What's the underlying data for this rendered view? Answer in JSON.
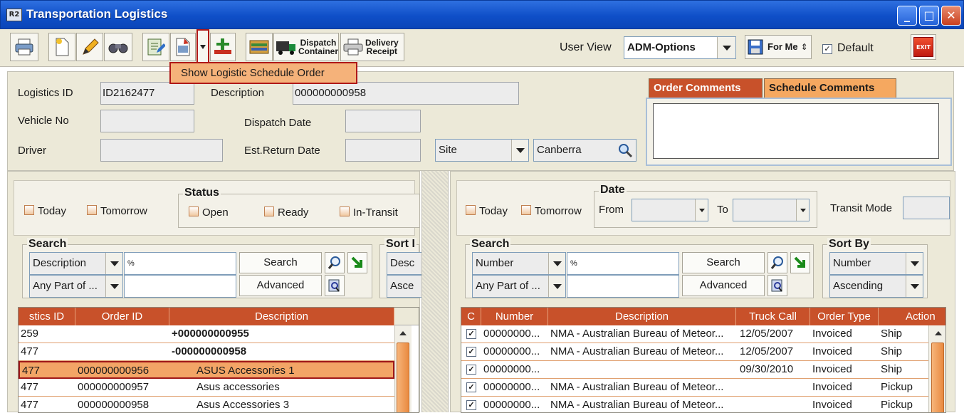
{
  "window": {
    "title": "Transportation Logistics",
    "icon_text": "R2"
  },
  "toolbar": {
    "dispatch_label_1": "Dispatch",
    "dispatch_label_2": "Container",
    "delivery_label_1": "Delivery",
    "delivery_label_2": "Receipt",
    "user_view_label": "User View",
    "user_view_value": "ADM-Options",
    "for_me_label": "For Me",
    "default_label": "Default",
    "exit_label": "EXIT"
  },
  "popup": {
    "label": "Show Logistic Schedule Order"
  },
  "form": {
    "logistics_id_label": "Logistics ID",
    "logistics_id_value": "ID2162477",
    "description_label": "Description",
    "description_value": "000000000958",
    "vehicle_no_label": "Vehicle No",
    "dispatch_date_label": "Dispatch Date",
    "driver_label": "Driver",
    "est_return_label": "Est.Return Date",
    "site_select": "Site",
    "site_value": "Canberra",
    "tabs": [
      "Order Comments",
      "Schedule Comments"
    ]
  },
  "left": {
    "today": "Today",
    "tomorrow": "Tomorrow",
    "status_title": "Status",
    "status_open": "Open",
    "status_ready": "Ready",
    "status_intransit": "In-Transit",
    "search_title": "Search",
    "search_field": "Description",
    "search_value": "%",
    "search_button": "Search",
    "match_mode": "Any Part of ...",
    "advanced_button": "Advanced",
    "sort_title": "Sort I",
    "sort_field": "Desc",
    "sort_order": "Asce",
    "columns": [
      "stics ID",
      "Order ID",
      "Description"
    ],
    "rows": [
      {
        "id": "259",
        "order": "",
        "desc": "+000000000955"
      },
      {
        "id": "477",
        "order": "",
        "desc": "-000000000958"
      },
      {
        "id": "477",
        "order": "000000000956",
        "desc": "ASUS Accessories 1"
      },
      {
        "id": "477",
        "order": "000000000957",
        "desc": "Asus accessories"
      },
      {
        "id": "477",
        "order": "000000000958",
        "desc": "Asus Accessories 3"
      }
    ]
  },
  "right": {
    "today": "Today",
    "tomorrow": "Tomorrow",
    "date_title": "Date",
    "from_label": "From",
    "to_label": "To",
    "transit_mode_label": "Transit Mode",
    "search_title": "Search",
    "search_field": "Number",
    "search_value": "%",
    "search_button": "Search",
    "match_mode": "Any Part of ...",
    "advanced_button": "Advanced",
    "sort_title": "Sort By",
    "sort_field": "Number",
    "sort_order": "Ascending",
    "columns": [
      "C",
      "Number",
      "Description",
      "Truck Call",
      "Order Type",
      "Action"
    ],
    "rows": [
      {
        "number": "00000000...",
        "desc": "NMA - Australian Bureau of Meteor...",
        "truck": "12/05/2007",
        "type": "Invoiced",
        "action": "Ship"
      },
      {
        "number": "00000000...",
        "desc": "NMA - Australian Bureau of Meteor...",
        "truck": "12/05/2007",
        "type": "Invoiced",
        "action": "Ship"
      },
      {
        "number": "00000000...",
        "desc": "",
        "truck": "09/30/2010",
        "type": "Invoiced",
        "action": "Ship"
      },
      {
        "number": "00000000...",
        "desc": "NMA - Australian Bureau of Meteor...",
        "truck": "",
        "type": "Invoiced",
        "action": "Pickup"
      },
      {
        "number": "00000000...",
        "desc": "NMA - Australian Bureau of Meteor...",
        "truck": "",
        "type": "Invoiced",
        "action": "Pickup"
      }
    ]
  }
}
